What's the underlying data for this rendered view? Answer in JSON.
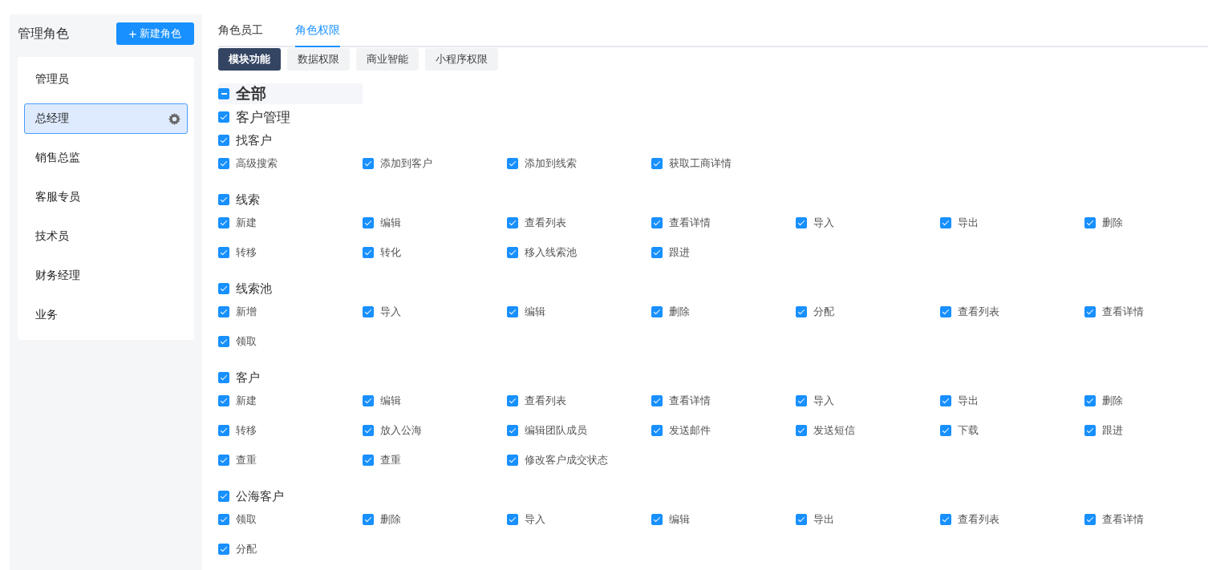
{
  "sidebar": {
    "title": "管理角色",
    "new_button": {
      "icon": "+",
      "label": "新建角色"
    },
    "roles": [
      {
        "label": "管理员",
        "selected": false
      },
      {
        "label": "总经理",
        "selected": true
      },
      {
        "label": "销售总监",
        "selected": false
      },
      {
        "label": "客服专员",
        "selected": false
      },
      {
        "label": "技术员",
        "selected": false
      },
      {
        "label": "财务经理",
        "selected": false
      },
      {
        "label": "业务",
        "selected": false
      }
    ]
  },
  "tabs": [
    {
      "label": "角色员工",
      "selected": false
    },
    {
      "label": "角色权限",
      "selected": true
    }
  ],
  "sub_tabs": [
    {
      "label": "模块功能",
      "selected": true
    },
    {
      "label": "数据权限",
      "selected": false
    },
    {
      "label": "商业智能",
      "selected": false
    },
    {
      "label": "小程序权限",
      "selected": false
    }
  ],
  "tree": {
    "all": {
      "label": "全部",
      "indeterminate": true
    },
    "module": {
      "label": "客户管理",
      "checked": true
    },
    "groups": [
      {
        "label": "找客户",
        "checked": true,
        "items": [
          {
            "label": "高级搜索",
            "checked": true
          },
          {
            "label": "添加到客户",
            "checked": true
          },
          {
            "label": "添加到线索",
            "checked": true
          },
          {
            "label": "获取工商详情",
            "checked": true
          }
        ]
      },
      {
        "label": "线索",
        "checked": true,
        "items": [
          {
            "label": "新建",
            "checked": true
          },
          {
            "label": "编辑",
            "checked": true
          },
          {
            "label": "查看列表",
            "checked": true
          },
          {
            "label": "查看详情",
            "checked": true
          },
          {
            "label": "导入",
            "checked": true
          },
          {
            "label": "导出",
            "checked": true
          },
          {
            "label": "删除",
            "checked": true
          },
          {
            "label": "转移",
            "checked": true
          },
          {
            "label": "转化",
            "checked": true
          },
          {
            "label": "移入线索池",
            "checked": true
          },
          {
            "label": "跟进",
            "checked": true
          }
        ]
      },
      {
        "label": "线索池",
        "checked": true,
        "items": [
          {
            "label": "新增",
            "checked": true
          },
          {
            "label": "导入",
            "checked": true
          },
          {
            "label": "编辑",
            "checked": true
          },
          {
            "label": "删除",
            "checked": true
          },
          {
            "label": "分配",
            "checked": true
          },
          {
            "label": "查看列表",
            "checked": true
          },
          {
            "label": "查看详情",
            "checked": true
          },
          {
            "label": "领取",
            "checked": true
          }
        ]
      },
      {
        "label": "客户",
        "checked": true,
        "items": [
          {
            "label": "新建",
            "checked": true
          },
          {
            "label": "编辑",
            "checked": true
          },
          {
            "label": "查看列表",
            "checked": true
          },
          {
            "label": "查看详情",
            "checked": true
          },
          {
            "label": "导入",
            "checked": true
          },
          {
            "label": "导出",
            "checked": true
          },
          {
            "label": "删除",
            "checked": true
          },
          {
            "label": "转移",
            "checked": true
          },
          {
            "label": "放入公海",
            "checked": true
          },
          {
            "label": "编辑团队成员",
            "checked": true
          },
          {
            "label": "发送邮件",
            "checked": true
          },
          {
            "label": "发送短信",
            "checked": true
          },
          {
            "label": "下载",
            "checked": true
          },
          {
            "label": "跟进",
            "checked": true
          },
          {
            "label": "查重",
            "checked": true
          },
          {
            "label": "查重",
            "checked": true
          },
          {
            "label": "修改客户成交状态",
            "checked": true
          }
        ]
      },
      {
        "label": "公海客户",
        "checked": true,
        "items": [
          {
            "label": "领取",
            "checked": true
          },
          {
            "label": "删除",
            "checked": true
          },
          {
            "label": "导入",
            "checked": true
          },
          {
            "label": "编辑",
            "checked": true
          },
          {
            "label": "导出",
            "checked": true
          },
          {
            "label": "查看列表",
            "checked": true
          },
          {
            "label": "查看详情",
            "checked": true
          },
          {
            "label": "分配",
            "checked": true
          }
        ]
      }
    ]
  }
}
